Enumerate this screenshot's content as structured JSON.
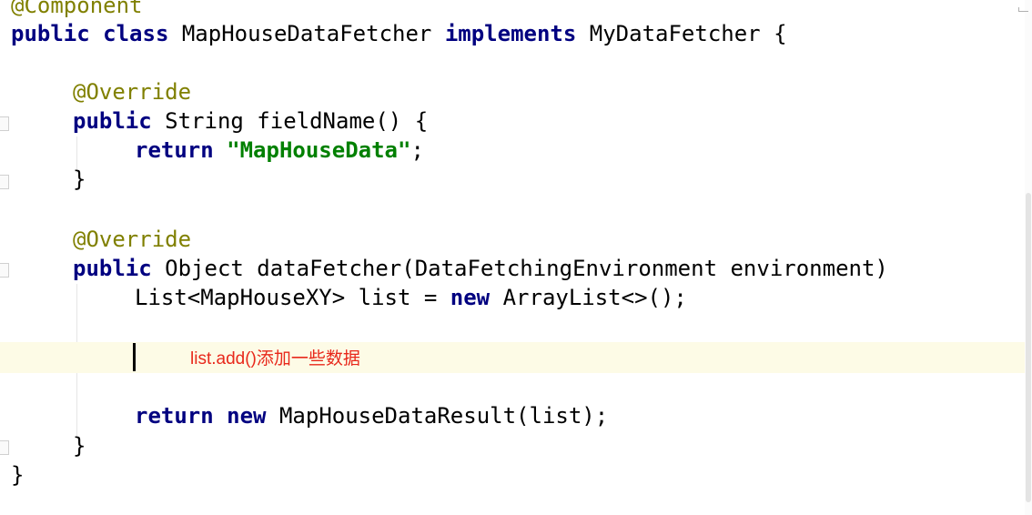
{
  "code": {
    "line0": {
      "text": "@Component"
    },
    "line1": {
      "kw1": "public class",
      "name": " MapHouseDataFetcher ",
      "kw2": "implements",
      "rest": " MyDataFetcher {"
    },
    "line2": {
      "ann": "@Override"
    },
    "line3": {
      "kw": "public",
      "rest": " String fieldName() {"
    },
    "line4": {
      "kw": "return",
      "space": " ",
      "str": "\"MapHouseData\"",
      "end": ";"
    },
    "line5": {
      "text": "}"
    },
    "line6": {
      "ann": "@Override"
    },
    "line7": {
      "kw": "public",
      "rest": " Object dataFetcher(DataFetchingEnvironment environment)"
    },
    "line8": {
      "pre": "List<MapHouseXY> list = ",
      "kw": "new",
      "rest": " ArrayList<>();"
    },
    "line9": {
      "kw1": "return",
      "space": " ",
      "kw2": "new",
      "rest": " MapHouseDataResult(list);"
    },
    "line10": {
      "text": "}"
    },
    "line11": {
      "text": "}"
    }
  },
  "annotation": {
    "text": "list.add()添加一些数据",
    "color": "#e8281b"
  },
  "colors": {
    "keyword": "#000080",
    "annotation": "#808000",
    "string": "#008000",
    "current_line": "#fdfbe6"
  }
}
